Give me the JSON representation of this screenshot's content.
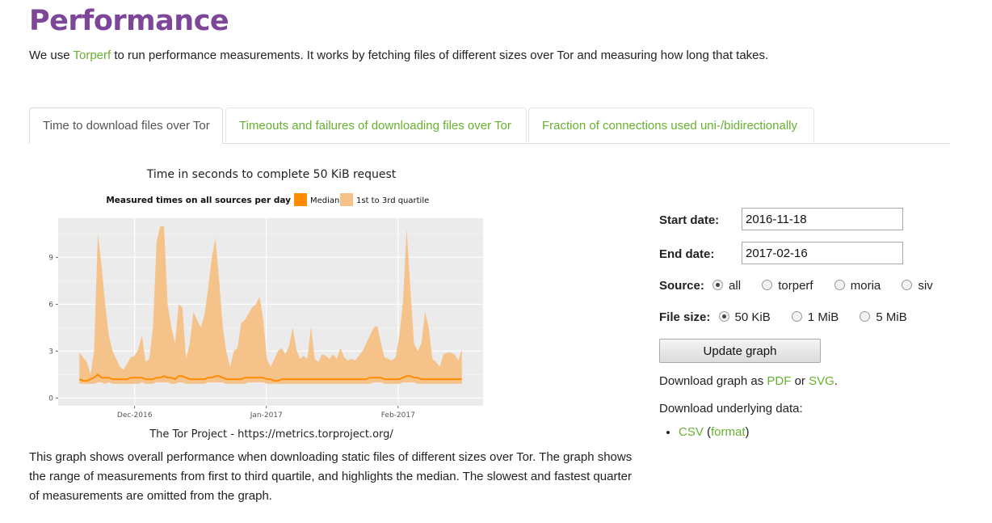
{
  "page": {
    "title": "Performance",
    "intro_prefix": "We use ",
    "intro_link": "Torperf",
    "intro_suffix": " to run performance measurements. It works by fetching files of different sizes over Tor and measuring how long that takes."
  },
  "tabs": [
    {
      "label": "Time to download files over Tor",
      "active": true
    },
    {
      "label": "Timeouts and failures of downloading files over Tor",
      "active": false
    },
    {
      "label": "Fraction of connections used uni-/bidirectionally",
      "active": false
    }
  ],
  "chart_data": {
    "type": "area",
    "title": "Time in seconds to complete 50 KiB request",
    "legend_title": "Measured times on all sources per day",
    "legend": [
      "Median",
      "1st to 3rd quartile"
    ],
    "legend_position": "top",
    "x_start": "2016-11-18",
    "x_end": "2017-02-16",
    "x_ticks": [
      "Dec-2016",
      "Jan-2017",
      "Feb-2017"
    ],
    "y_ticks": [
      0,
      3,
      6,
      9
    ],
    "ylim": [
      -0.5,
      11.5
    ],
    "grid": true,
    "colors": {
      "median": "#ff8c00",
      "quartile": "#f5c28a",
      "panel": "#ebebeb"
    },
    "credit": "The Tor Project - https://metrics.torproject.org/",
    "upper": [
      2.9,
      2.6,
      2.3,
      1.5,
      3.0,
      10.5,
      8.5,
      6.0,
      4.0,
      3.0,
      2.5,
      2.0,
      1.8,
      2.2,
      2.6,
      2.7,
      3.1,
      4.0,
      2.3,
      2.5,
      4.5,
      10.0,
      11.0,
      11.0,
      6.0,
      4.5,
      3.5,
      6.0,
      5.8,
      2.5,
      3.5,
      5.5,
      5.0,
      4.5,
      5.3,
      7.0,
      9.0,
      10.2,
      7.5,
      4.5,
      2.9,
      2.0,
      3.0,
      3.2,
      4.8,
      5.0,
      5.4,
      5.8,
      6.0,
      6.5,
      5.0,
      2.5,
      2.0,
      2.5,
      3.0,
      3.2,
      2.8,
      3.3,
      4.5,
      3.1,
      2.5,
      2.7,
      2.5,
      4.6,
      2.5,
      2.3,
      2.8,
      2.7,
      2.5,
      2.8,
      2.5,
      3.2,
      2.6,
      2.4,
      2.5,
      2.4,
      2.7,
      3.0,
      3.5,
      4.0,
      4.5,
      4.6,
      3.5,
      2.6,
      2.5,
      2.4,
      2.6,
      4.0,
      6.2,
      10.8,
      7.0,
      3.5,
      3.0,
      3.5,
      5.5,
      4.5,
      2.5,
      2.3,
      2.0,
      2.8,
      2.9,
      2.9,
      2.8,
      2.4,
      3.1
    ],
    "lower": [
      0.9,
      0.9,
      0.9,
      0.9,
      0.9,
      1.0,
      1.0,
      0.9,
      1.0,
      0.9,
      0.9,
      0.9,
      0.9,
      0.9,
      0.9,
      0.9,
      0.9,
      1.0,
      0.9,
      0.9,
      0.9,
      1.0,
      1.0,
      1.0,
      1.0,
      0.9,
      0.9,
      1.0,
      1.0,
      0.9,
      0.9,
      0.9,
      0.9,
      0.9,
      0.9,
      1.0,
      1.0,
      1.0,
      1.0,
      1.0,
      0.9,
      0.9,
      0.9,
      0.9,
      0.9,
      0.9,
      1.0,
      1.0,
      1.0,
      1.0,
      1.0,
      0.9,
      0.9,
      0.9,
      0.9,
      0.9,
      0.9,
      0.9,
      0.9,
      0.9,
      0.9,
      0.9,
      0.9,
      0.9,
      0.9,
      0.9,
      0.9,
      0.9,
      0.9,
      0.9,
      0.9,
      0.9,
      0.9,
      0.9,
      0.9,
      0.9,
      0.9,
      0.9,
      0.9,
      0.9,
      1.0,
      1.0,
      1.0,
      0.9,
      0.9,
      0.9,
      0.9,
      0.9,
      1.0,
      1.0,
      1.0,
      1.0,
      0.9,
      0.9,
      0.9,
      0.9,
      0.9,
      0.9,
      0.9,
      0.9,
      0.9,
      0.9,
      0.9,
      0.9,
      0.9
    ],
    "median": [
      1.2,
      1.1,
      1.1,
      1.2,
      1.3,
      1.5,
      1.3,
      1.3,
      1.3,
      1.2,
      1.2,
      1.2,
      1.2,
      1.2,
      1.3,
      1.3,
      1.3,
      1.3,
      1.2,
      1.2,
      1.2,
      1.3,
      1.3,
      1.4,
      1.3,
      1.3,
      1.2,
      1.4,
      1.4,
      1.3,
      1.2,
      1.2,
      1.2,
      1.2,
      1.2,
      1.3,
      1.3,
      1.4,
      1.4,
      1.3,
      1.2,
      1.2,
      1.2,
      1.2,
      1.2,
      1.3,
      1.3,
      1.3,
      1.3,
      1.3,
      1.3,
      1.2,
      1.2,
      1.1,
      1.1,
      1.2,
      1.2,
      1.2,
      1.2,
      1.2,
      1.2,
      1.2,
      1.2,
      1.2,
      1.2,
      1.2,
      1.2,
      1.2,
      1.2,
      1.2,
      1.2,
      1.2,
      1.2,
      1.2,
      1.2,
      1.2,
      1.2,
      1.2,
      1.2,
      1.3,
      1.3,
      1.3,
      1.3,
      1.2,
      1.2,
      1.2,
      1.2,
      1.2,
      1.3,
      1.4,
      1.4,
      1.3,
      1.3,
      1.2,
      1.2,
      1.2,
      1.2,
      1.2,
      1.2,
      1.2,
      1.2,
      1.2,
      1.2,
      1.2,
      1.2
    ]
  },
  "controls": {
    "start_label": "Start date:",
    "start_value": "2016-11-18",
    "end_label": "End date:",
    "end_value": "2017-02-16",
    "source_label": "Source:",
    "sources": [
      {
        "label": "all",
        "checked": true
      },
      {
        "label": "torperf",
        "checked": false
      },
      {
        "label": "moria",
        "checked": false
      },
      {
        "label": "siv",
        "checked": false
      }
    ],
    "filesize_label": "File size:",
    "filesizes": [
      {
        "label": "50 KiB",
        "checked": true
      },
      {
        "label": "1 MiB",
        "checked": false
      },
      {
        "label": "5 MiB",
        "checked": false
      }
    ],
    "update_button": "Update graph",
    "download_prefix": "Download graph as ",
    "pdf": "PDF",
    "or": " or ",
    "svg": "SVG",
    "period": ".",
    "data_label": "Download underlying data:",
    "csv": "CSV",
    "paren_open": " (",
    "format": "format",
    "paren_close": ")"
  },
  "description": "This graph shows overall performance when downloading static files of different sizes over Tor. The graph shows the range of measurements from first to third quartile, and highlights the median. The slowest and fastest quarter of measurements are omitted from the graph."
}
